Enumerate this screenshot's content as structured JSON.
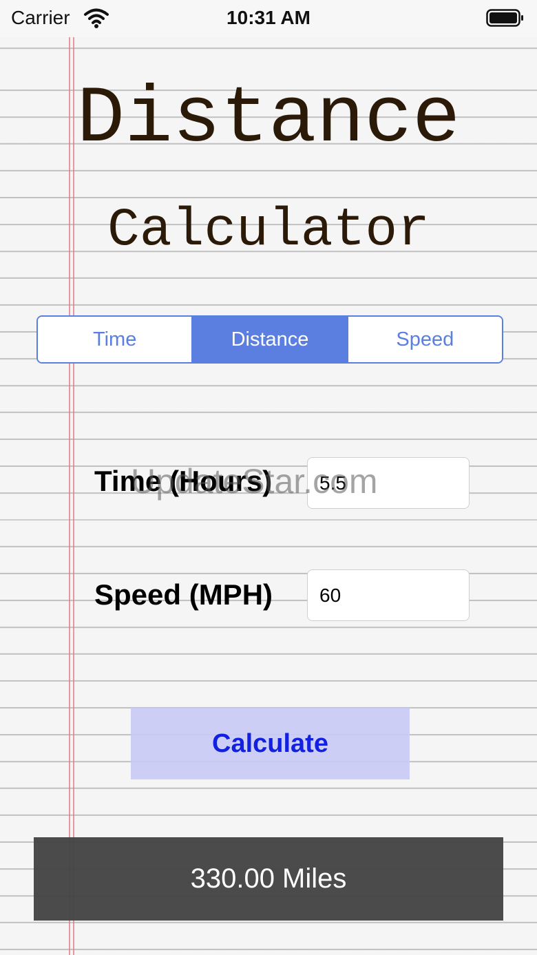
{
  "status_bar": {
    "carrier": "Carrier",
    "time": "10:31 AM",
    "wifi_icon": "wifi-icon",
    "battery_icon": "battery-icon"
  },
  "title": {
    "line1": "Distance",
    "line2": "Calculator",
    "color": "#2b1a08"
  },
  "mode_selector": {
    "segments": [
      "Time",
      "Distance",
      "Speed"
    ],
    "selected": "Distance",
    "accent_color": "#5b7fe0"
  },
  "form": {
    "time_label": "Time (Hours)",
    "time_value": "5.5",
    "speed_label": "Speed (MPH)",
    "speed_value": "60"
  },
  "calculate_label": "Calculate",
  "result": "330.00 Miles",
  "watermark": "UpdateStar.com"
}
